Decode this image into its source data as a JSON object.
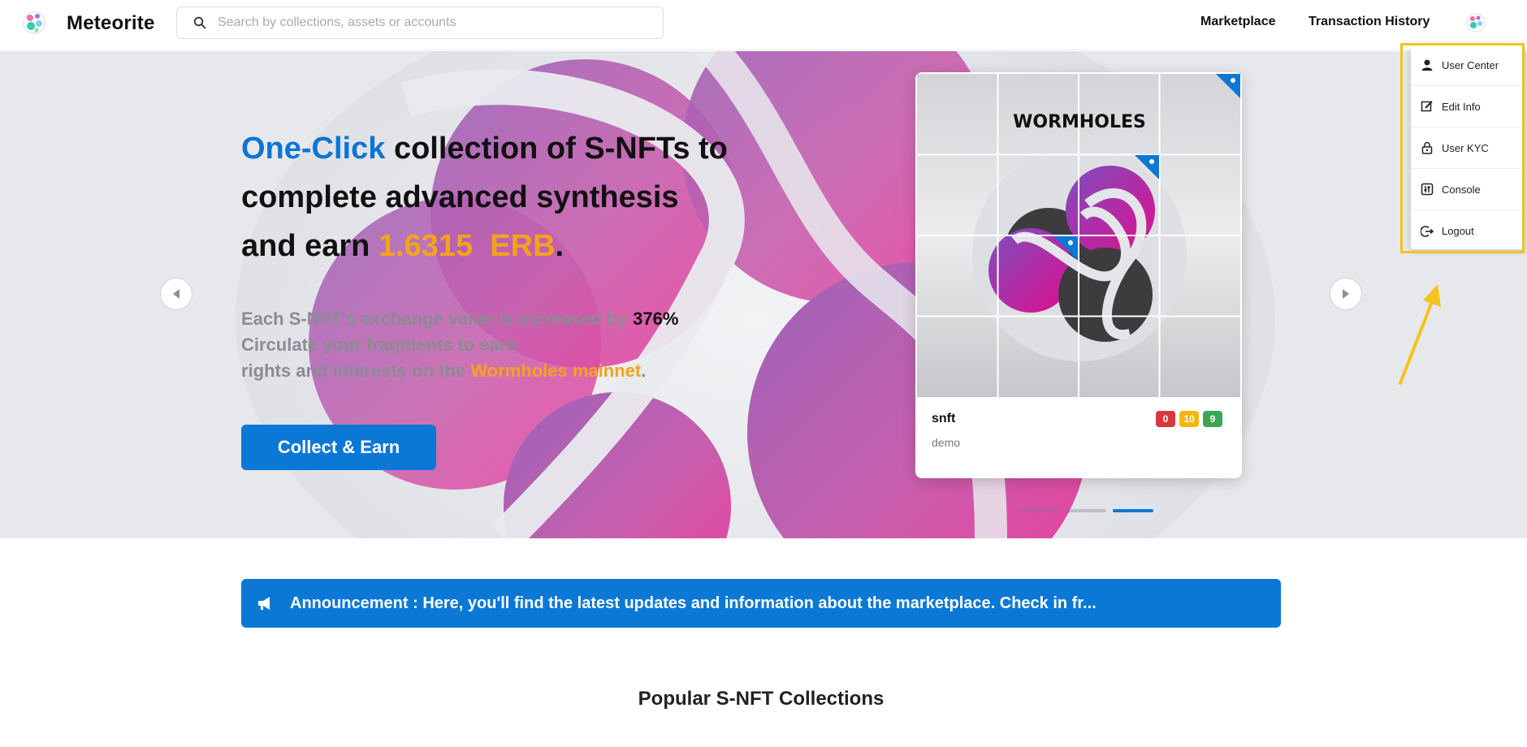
{
  "header": {
    "brand": "Meteorite",
    "search_placeholder": "Search by collections, assets or accounts",
    "nav": {
      "marketplace": "Marketplace",
      "transaction_history": "Transaction History"
    }
  },
  "hero": {
    "headline": {
      "blue": "One-Click",
      "line1_rest": " collection of S-NFTs to",
      "line2": "complete advanced synthesis",
      "line3_prefix": "and earn ",
      "amount": "1.6315  ERB",
      "suffix": "."
    },
    "sub": {
      "line1": "Each S-NFT's exchange value is increased by ",
      "percent": "376%",
      "line2": "Circulate your fragments to earn",
      "line3_prefix": "rights and interests on the ",
      "mainnet": "Wormholes mainnet",
      "line3_suffix": "."
    },
    "cta": "Collect & Earn",
    "carousel": {
      "active_index": 2,
      "count": 3
    },
    "card": {
      "image_text": "WORMHOLES",
      "title": "snft",
      "subtitle": "demo",
      "badges": [
        {
          "value": "0",
          "color": "#d9363e"
        },
        {
          "value": "10",
          "color": "#f5b50a"
        },
        {
          "value": "9",
          "color": "#3aa755"
        }
      ]
    }
  },
  "user_menu": {
    "items": [
      {
        "label": "User Center",
        "icon": "user-icon"
      },
      {
        "label": "Edit Info",
        "icon": "edit-icon"
      },
      {
        "label": "User KYC",
        "icon": "lock-icon"
      },
      {
        "label": "Console",
        "icon": "console-icon"
      },
      {
        "label": "Logout",
        "icon": "logout-icon"
      }
    ]
  },
  "announcement": {
    "text": "Announcement : Here, you'll find the latest updates and information about the marketplace. Check in fr..."
  },
  "sections": {
    "popular_title": "Popular S-NFT Collections"
  },
  "colors": {
    "accent": "#0b78d6",
    "highlight": "#f4a31b",
    "annotation": "#f6c21c"
  }
}
